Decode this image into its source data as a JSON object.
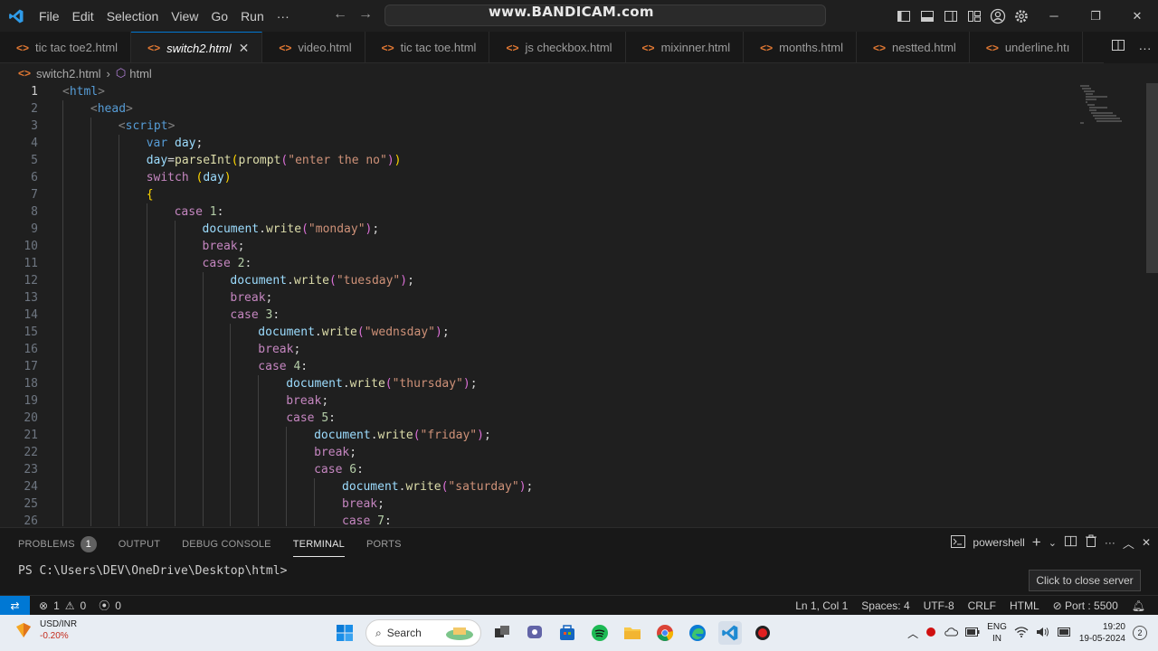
{
  "titlebar": {
    "menu": [
      "File",
      "Edit",
      "Selection",
      "View",
      "Go",
      "Run",
      "···"
    ],
    "watermark": "www.BANDICAM.com"
  },
  "tabs": [
    {
      "label": "tic tac toe2.html",
      "active": false
    },
    {
      "label": "switch2.html",
      "active": true
    },
    {
      "label": "video.html",
      "active": false
    },
    {
      "label": "tic tac toe.html",
      "active": false
    },
    {
      "label": "js checkbox.html",
      "active": false
    },
    {
      "label": "mixinner.html",
      "active": false
    },
    {
      "label": "months.html",
      "active": false
    },
    {
      "label": "nestted.html",
      "active": false
    },
    {
      "label": "underline.htı",
      "active": false
    }
  ],
  "breadcrumb": {
    "file": "switch2.html",
    "symbol": "html"
  },
  "editor": {
    "current_line": 1,
    "lines": [
      {
        "n": "1",
        "indent": 0,
        "tokens": [
          [
            "tag",
            "<"
          ],
          [
            "tn",
            "html"
          ],
          [
            "tag",
            ">"
          ]
        ]
      },
      {
        "n": "2",
        "indent": 1,
        "tokens": [
          [
            "tag",
            "<"
          ],
          [
            "tn",
            "head"
          ],
          [
            "tag",
            ">"
          ]
        ]
      },
      {
        "n": "3",
        "indent": 2,
        "tokens": [
          [
            "tag",
            "<"
          ],
          [
            "tn",
            "script"
          ],
          [
            "tag",
            ">"
          ]
        ]
      },
      {
        "n": "4",
        "indent": 3,
        "tokens": [
          [
            "kw",
            "var"
          ],
          [
            "pl",
            " "
          ],
          [
            "vr",
            "day"
          ],
          [
            "pl",
            ";"
          ]
        ]
      },
      {
        "n": "5",
        "indent": 3,
        "tokens": [
          [
            "vr",
            "day"
          ],
          [
            "pl",
            "="
          ],
          [
            "fn",
            "parseInt"
          ],
          [
            "br1",
            "("
          ],
          [
            "fn",
            "prompt"
          ],
          [
            "br2",
            "("
          ],
          [
            "st",
            "\"enter the no\""
          ],
          [
            "br2",
            ")"
          ],
          [
            "br1",
            ")"
          ]
        ]
      },
      {
        "n": "6",
        "indent": 3,
        "tokens": [
          [
            "ctl",
            "switch"
          ],
          [
            "pl",
            " "
          ],
          [
            "br1",
            "("
          ],
          [
            "vr",
            "day"
          ],
          [
            "br1",
            ")"
          ]
        ]
      },
      {
        "n": "7",
        "indent": 3,
        "tokens": [
          [
            "br1",
            "{"
          ]
        ]
      },
      {
        "n": "8",
        "indent": 4,
        "tokens": [
          [
            "ctl",
            "case"
          ],
          [
            "pl",
            " "
          ],
          [
            "nm",
            "1"
          ],
          [
            "pl",
            ":"
          ]
        ]
      },
      {
        "n": "9",
        "indent": 5,
        "tokens": [
          [
            "vr",
            "document"
          ],
          [
            "pl",
            "."
          ],
          [
            "fn",
            "write"
          ],
          [
            "br2",
            "("
          ],
          [
            "st",
            "\"monday\""
          ],
          [
            "br2",
            ")"
          ],
          [
            "pl",
            ";"
          ]
        ]
      },
      {
        "n": "10",
        "indent": 5,
        "tokens": [
          [
            "ctl",
            "break"
          ],
          [
            "pl",
            ";"
          ]
        ]
      },
      {
        "n": "11",
        "indent": 5,
        "tokens": [
          [
            "ctl",
            "case"
          ],
          [
            "pl",
            " "
          ],
          [
            "nm",
            "2"
          ],
          [
            "pl",
            ":"
          ]
        ]
      },
      {
        "n": "12",
        "indent": 6,
        "tokens": [
          [
            "vr",
            "document"
          ],
          [
            "pl",
            "."
          ],
          [
            "fn",
            "write"
          ],
          [
            "br2",
            "("
          ],
          [
            "st",
            "\"tuesday\""
          ],
          [
            "br2",
            ")"
          ],
          [
            "pl",
            ";"
          ]
        ]
      },
      {
        "n": "13",
        "indent": 6,
        "tokens": [
          [
            "ctl",
            "break"
          ],
          [
            "pl",
            ";"
          ]
        ]
      },
      {
        "n": "14",
        "indent": 6,
        "tokens": [
          [
            "ctl",
            "case"
          ],
          [
            "pl",
            " "
          ],
          [
            "nm",
            "3"
          ],
          [
            "pl",
            ":"
          ]
        ]
      },
      {
        "n": "15",
        "indent": 7,
        "tokens": [
          [
            "vr",
            "document"
          ],
          [
            "pl",
            "."
          ],
          [
            "fn",
            "write"
          ],
          [
            "br2",
            "("
          ],
          [
            "st",
            "\"wednsday\""
          ],
          [
            "br2",
            ")"
          ],
          [
            "pl",
            ";"
          ]
        ]
      },
      {
        "n": "16",
        "indent": 7,
        "tokens": [
          [
            "ctl",
            "break"
          ],
          [
            "pl",
            ";"
          ]
        ]
      },
      {
        "n": "17",
        "indent": 7,
        "tokens": [
          [
            "ctl",
            "case"
          ],
          [
            "pl",
            " "
          ],
          [
            "nm",
            "4"
          ],
          [
            "pl",
            ":"
          ]
        ]
      },
      {
        "n": "18",
        "indent": 8,
        "tokens": [
          [
            "vr",
            "document"
          ],
          [
            "pl",
            "."
          ],
          [
            "fn",
            "write"
          ],
          [
            "br2",
            "("
          ],
          [
            "st",
            "\"thursday\""
          ],
          [
            "br2",
            ")"
          ],
          [
            "pl",
            ";"
          ]
        ]
      },
      {
        "n": "19",
        "indent": 8,
        "tokens": [
          [
            "ctl",
            "break"
          ],
          [
            "pl",
            ";"
          ]
        ]
      },
      {
        "n": "20",
        "indent": 8,
        "tokens": [
          [
            "ctl",
            "case"
          ],
          [
            "pl",
            " "
          ],
          [
            "nm",
            "5"
          ],
          [
            "pl",
            ":"
          ]
        ]
      },
      {
        "n": "21",
        "indent": 9,
        "tokens": [
          [
            "vr",
            "document"
          ],
          [
            "pl",
            "."
          ],
          [
            "fn",
            "write"
          ],
          [
            "br2",
            "("
          ],
          [
            "st",
            "\"friday\""
          ],
          [
            "br2",
            ")"
          ],
          [
            "pl",
            ";"
          ]
        ]
      },
      {
        "n": "22",
        "indent": 9,
        "tokens": [
          [
            "ctl",
            "break"
          ],
          [
            "pl",
            ";"
          ]
        ]
      },
      {
        "n": "23",
        "indent": 9,
        "tokens": [
          [
            "ctl",
            "case"
          ],
          [
            "pl",
            " "
          ],
          [
            "nm",
            "6"
          ],
          [
            "pl",
            ":"
          ]
        ]
      },
      {
        "n": "24",
        "indent": 10,
        "tokens": [
          [
            "vr",
            "document"
          ],
          [
            "pl",
            "."
          ],
          [
            "fn",
            "write"
          ],
          [
            "br2",
            "("
          ],
          [
            "st",
            "\"saturday\""
          ],
          [
            "br2",
            ")"
          ],
          [
            "pl",
            ";"
          ]
        ]
      },
      {
        "n": "25",
        "indent": 10,
        "tokens": [
          [
            "ctl",
            "break"
          ],
          [
            "pl",
            ";"
          ]
        ]
      },
      {
        "n": "26",
        "indent": 10,
        "tokens": [
          [
            "ctl",
            "case"
          ],
          [
            "pl",
            " "
          ],
          [
            "nm",
            "7"
          ],
          [
            "pl",
            ":"
          ]
        ]
      }
    ]
  },
  "panel": {
    "tabs": [
      {
        "label": "PROBLEMS",
        "badge": "1",
        "active": false
      },
      {
        "label": "OUTPUT",
        "active": false
      },
      {
        "label": "DEBUG CONSOLE",
        "active": false
      },
      {
        "label": "TERMINAL",
        "active": true
      },
      {
        "label": "PORTS",
        "active": false
      }
    ],
    "shell": "powershell",
    "prompt": "PS C:\\Users\\DEV\\OneDrive\\Desktop\\html>",
    "tooltip": "Click to close server"
  },
  "statusbar": {
    "errors": "1",
    "warnings": "0",
    "ports": "0",
    "position": "Ln 1, Col 1",
    "spaces": "Spaces: 4",
    "encoding": "UTF-8",
    "eol": "CRLF",
    "language": "HTML",
    "port": "Port : 5500"
  },
  "taskbar": {
    "weather_title": "USD/INR",
    "weather_change": "-0.20%",
    "search": "Search",
    "lang_top": "ENG",
    "lang_bottom": "IN",
    "time": "19:20",
    "date": "19-05-2024",
    "notif": "2"
  },
  "colors": {
    "accent": "#0078d4",
    "editor_bg": "#1f1f1f",
    "tab_icon": "#e37933"
  }
}
